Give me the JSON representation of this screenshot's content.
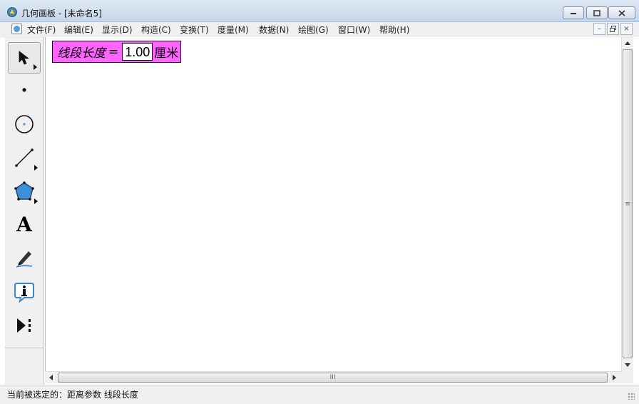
{
  "window": {
    "title": "几何画板 - [未命名5]",
    "minimize_icon": "minimize-icon",
    "maximize_icon": "maximize-icon",
    "close_icon": "close-icon"
  },
  "menubar": {
    "items": [
      "文件(F)",
      "编辑(E)",
      "显示(D)",
      "构造(C)",
      "变换(T)",
      "度量(M)",
      "数据(N)",
      "绘图(G)",
      "窗口(W)",
      "帮助(H)"
    ],
    "mdi_minimize": "–",
    "mdi_restore": "🗗",
    "mdi_close": "×"
  },
  "toolbox": {
    "tools": [
      {
        "name": "arrow-select-tool",
        "icon": "arrow-icon",
        "selected": true
      },
      {
        "name": "point-tool",
        "icon": "point-icon"
      },
      {
        "name": "compass-tool",
        "icon": "circle-icon"
      },
      {
        "name": "straightedge-tool",
        "icon": "segment-icon"
      },
      {
        "name": "polygon-tool",
        "icon": "pentagon-icon"
      },
      {
        "name": "text-tool",
        "icon": "text-a-icon",
        "glyph": "A"
      },
      {
        "name": "marker-tool",
        "icon": "pen-icon"
      },
      {
        "name": "information-tool",
        "icon": "info-icon",
        "glyph": "i"
      },
      {
        "name": "custom-tool",
        "icon": "custom-tool-icon"
      }
    ]
  },
  "canvas": {
    "measurement": {
      "label": "线段长度",
      "equals": "=",
      "value": "1.00",
      "unit": "厘米"
    }
  },
  "scrollbars": {
    "grip": "III",
    "vgrip": "≡"
  },
  "status": {
    "text": "当前被选定的：距离参数 线段长度"
  },
  "colors": {
    "measurement_bg": "#ff66ff",
    "polygon_fill": "#3d8fd6",
    "pen_line": "#3a78c9"
  }
}
